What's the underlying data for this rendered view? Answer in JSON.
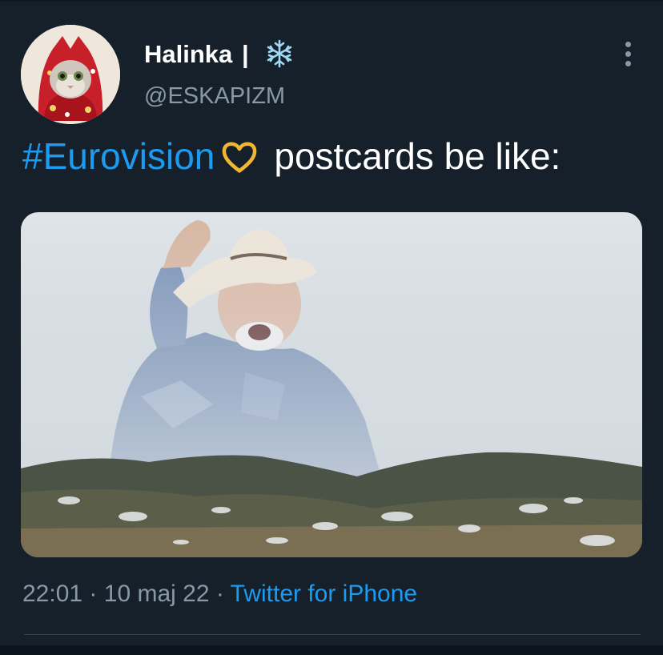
{
  "tweet": {
    "author": {
      "display_name": "Halinka",
      "separator": "|",
      "handle": "@ESKAPIZM",
      "badge_icon": "snowflake-icon",
      "avatar_icon": "cat-avatar"
    },
    "hashtag": "#Eurovision",
    "heart_icon": "gold-heart-icon",
    "text": "postcards be like:",
    "media": {
      "description_icon": "cowboy-mountain-meme-image"
    },
    "time": "22:01",
    "dot1": "·",
    "date": "10 maj 22",
    "dot2": "·",
    "source": "Twitter for iPhone"
  },
  "colors": {
    "background": "#15202b",
    "link": "#1d9bf0",
    "secondary_text": "#8899a6",
    "heart": "#f2b632"
  }
}
